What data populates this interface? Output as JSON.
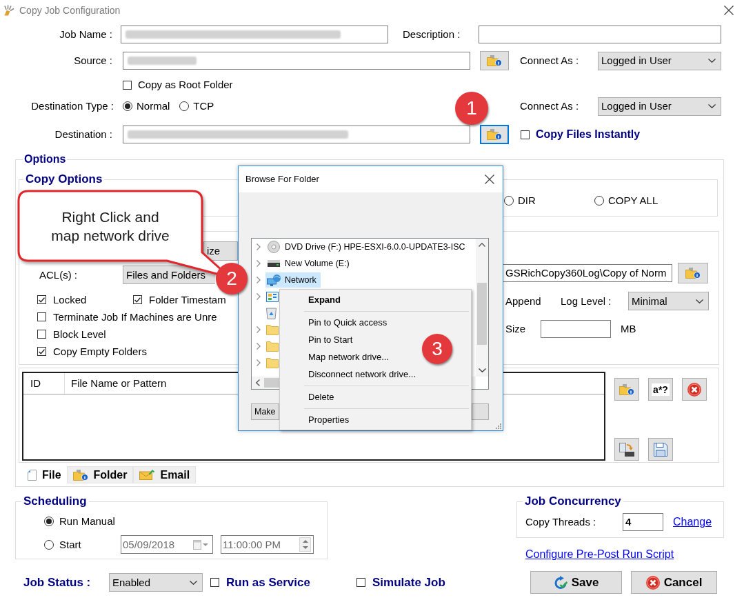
{
  "window": {
    "title": "Copy Job Configuration"
  },
  "job": {
    "name_label": "Job Name :",
    "description_label": "Description :"
  },
  "source": {
    "label": "Source :",
    "browse_focused": false,
    "connect_as_label": "Connect As :",
    "connect_as": "Logged in User"
  },
  "copy_as_root_folder": {
    "label": "Copy as Root Folder",
    "checked": false
  },
  "destination_type": {
    "label": "Destination Type :",
    "options": [
      {
        "label": "Normal",
        "selected": true
      },
      {
        "label": "TCP",
        "selected": false
      }
    ],
    "connect_as_label": "Connect As :",
    "connect_as": "Logged in User"
  },
  "destination": {
    "label": "Destination :",
    "browse_focused": true
  },
  "copy_files_instantly": {
    "label": "Copy Files Instantly",
    "checked": false
  },
  "options": {
    "title": "Options",
    "copy_options": {
      "title": "Copy Options",
      "modes": [
        {
          "label": "DIR",
          "selected": false
        },
        {
          "label": "COPY ALL",
          "selected": false
        }
      ]
    },
    "partial_button": "ize",
    "acl": {
      "label": "ACL(s) :",
      "value": "Files and Folders"
    },
    "checkboxes": [
      {
        "label": "Locked",
        "checked": true
      },
      {
        "label": "Folder Timestam",
        "checked": true
      },
      {
        "label": "Terminate Job If Machines are Unre",
        "checked": false
      },
      {
        "label": "Block Level",
        "checked": false
      },
      {
        "label": "Copy Empty Folders",
        "checked": true
      }
    ],
    "log": {
      "path": "GSRichCopy360Log\\Copy of Norm",
      "browse_focused": false,
      "append_label": "Append",
      "level_label": "Log Level :",
      "level": "Minimal",
      "size_label": "Size",
      "size_unit": "MB"
    },
    "filters": {
      "columns": [
        "ID",
        "File Name or Pattern"
      ],
      "tools": [
        {
          "kind": "folder-info"
        },
        {
          "kind": "pattern",
          "label": "a*?"
        },
        {
          "kind": "remove"
        },
        {
          "kind": "transfer"
        },
        {
          "kind": "save"
        }
      ]
    },
    "tabs": [
      {
        "label": "File",
        "kind": "file",
        "selected": true
      },
      {
        "label": "Folder",
        "kind": "folder",
        "selected": false
      },
      {
        "label": "Email",
        "kind": "email",
        "selected": false
      }
    ]
  },
  "scheduling": {
    "title": "Scheduling",
    "modes": [
      {
        "label": "Run Manual",
        "selected": true
      },
      {
        "label": "Start",
        "selected": false
      }
    ],
    "date": "05/09/2018",
    "time": "11:00:00 PM",
    "disabled": true
  },
  "job_concurrency": {
    "title": "Job Concurrency",
    "label": "Copy Threads :",
    "value": "4",
    "link": "Change"
  },
  "pre_post_link": "Configure Pre-Post Run Script",
  "job_status": {
    "label": "Job Status :",
    "value": "Enabled"
  },
  "flags": [
    {
      "label": "Run as Service",
      "checked": false
    },
    {
      "label": "Simulate Job",
      "checked": false
    }
  ],
  "buttons": [
    {
      "label": "Save",
      "kind": "save"
    },
    {
      "label": "Cancel",
      "kind": "cancel"
    }
  ],
  "browse_dialog": {
    "title": "Browse For Folder",
    "tree": [
      {
        "kind": "dvd",
        "label": "DVD Drive (F:) HPE-ESXI-6.0.0-UPDATE3-ISC",
        "expandable": true,
        "selected": false
      },
      {
        "kind": "drive",
        "label": "New Volume (E:)",
        "expandable": true,
        "selected": false
      },
      {
        "kind": "network",
        "label": "Network",
        "expandable": true,
        "selected": true
      },
      {
        "kind": "control-panel",
        "expandable": true,
        "selected": false
      },
      {
        "kind": "recycle-bin",
        "expandable": false,
        "selected": false
      },
      {
        "kind": "folder",
        "expandable": true,
        "selected": false
      },
      {
        "kind": "folder",
        "expandable": true,
        "selected": false
      },
      {
        "kind": "folder",
        "expandable": true,
        "selected": false
      }
    ],
    "partial_button": "Make"
  },
  "context_menu": [
    {
      "kind": "item",
      "label": "Expand",
      "default": true
    },
    {
      "kind": "separator"
    },
    {
      "kind": "item",
      "label": "Pin to Quick access",
      "default": false
    },
    {
      "kind": "item",
      "label": "Pin to Start",
      "default": false
    },
    {
      "kind": "item",
      "label": "Map network drive...",
      "default": false
    },
    {
      "kind": "item",
      "label": "Disconnect network drive...",
      "default": false
    },
    {
      "kind": "separator"
    },
    {
      "kind": "item",
      "label": "Delete",
      "default": false
    },
    {
      "kind": "separator"
    },
    {
      "kind": "item",
      "label": "Properties",
      "default": false
    }
  ],
  "callout": {
    "text": "Right Click and\nmap network drive"
  },
  "step_badges": [
    {
      "label": "1"
    },
    {
      "label": "2"
    },
    {
      "label": "3"
    }
  ]
}
